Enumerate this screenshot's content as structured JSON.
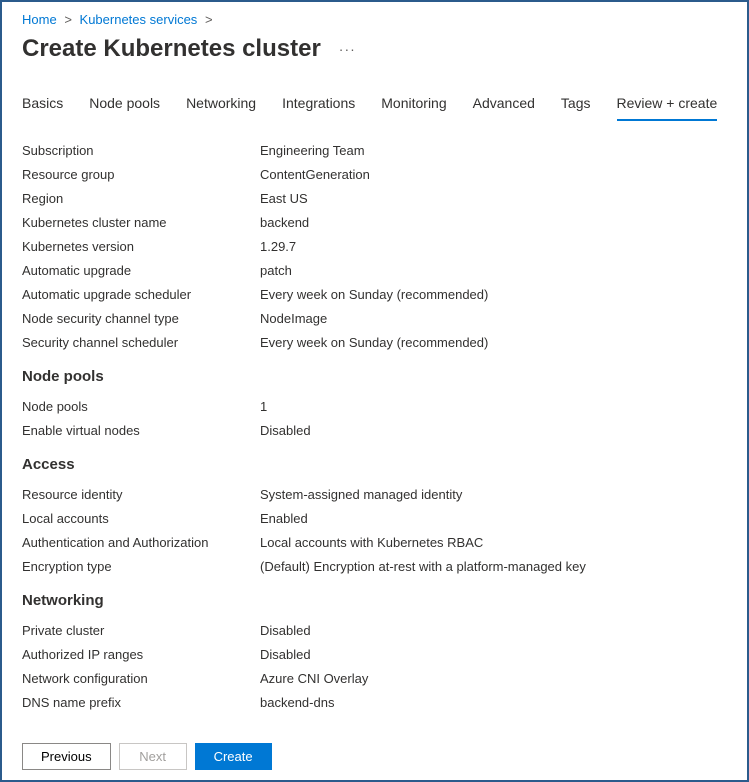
{
  "breadcrumb": {
    "items": [
      {
        "label": "Home"
      },
      {
        "label": "Kubernetes services"
      }
    ]
  },
  "page_title": "Create Kubernetes cluster",
  "tabs": [
    {
      "label": "Basics",
      "active": false
    },
    {
      "label": "Node pools",
      "active": false
    },
    {
      "label": "Networking",
      "active": false
    },
    {
      "label": "Integrations",
      "active": false
    },
    {
      "label": "Monitoring",
      "active": false
    },
    {
      "label": "Advanced",
      "active": false
    },
    {
      "label": "Tags",
      "active": false
    },
    {
      "label": "Review + create",
      "active": true
    }
  ],
  "summary": {
    "top": [
      {
        "label": "Subscription",
        "value": "Engineering Team"
      },
      {
        "label": "Resource group",
        "value": "ContentGeneration"
      },
      {
        "label": "Region",
        "value": "East US"
      },
      {
        "label": "Kubernetes cluster name",
        "value": "backend"
      },
      {
        "label": "Kubernetes version",
        "value": "1.29.7"
      },
      {
        "label": "Automatic upgrade",
        "value": "patch"
      },
      {
        "label": "Automatic upgrade scheduler",
        "value": "Every week on Sunday (recommended)"
      },
      {
        "label": "Node security channel type",
        "value": "NodeImage"
      },
      {
        "label": "Security channel scheduler",
        "value": "Every week on Sunday (recommended)"
      }
    ],
    "node_pools_heading": "Node pools",
    "node_pools": [
      {
        "label": "Node pools",
        "value": "1"
      },
      {
        "label": "Enable virtual nodes",
        "value": "Disabled"
      }
    ],
    "access_heading": "Access",
    "access": [
      {
        "label": "Resource identity",
        "value": "System-assigned managed identity"
      },
      {
        "label": "Local accounts",
        "value": "Enabled"
      },
      {
        "label": "Authentication and Authorization",
        "value": "Local accounts with Kubernetes RBAC"
      },
      {
        "label": "Encryption type",
        "value": "(Default) Encryption at-rest with a platform-managed key"
      }
    ],
    "networking_heading": "Networking",
    "networking": [
      {
        "label": "Private cluster",
        "value": "Disabled"
      },
      {
        "label": "Authorized IP ranges",
        "value": "Disabled"
      },
      {
        "label": "Network configuration",
        "value": "Azure CNI Overlay"
      },
      {
        "label": "DNS name prefix",
        "value": "backend-dns"
      }
    ]
  },
  "footer": {
    "previous": "Previous",
    "next": "Next",
    "create": "Create"
  }
}
